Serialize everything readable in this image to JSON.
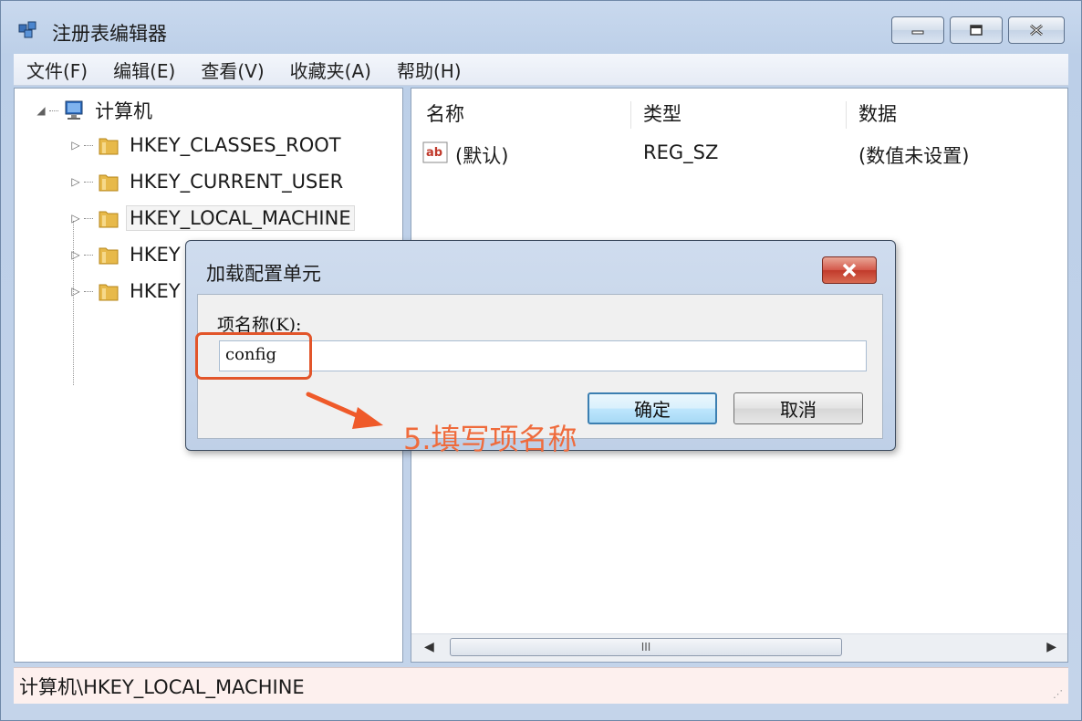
{
  "window": {
    "title": "注册表编辑器",
    "controls": {
      "minimize": "minimize-icon",
      "maximize": "maximize-icon",
      "close": "close-icon"
    }
  },
  "menu": {
    "items": [
      {
        "label": "文件(F)"
      },
      {
        "label": "编辑(E)"
      },
      {
        "label": "查看(V)"
      },
      {
        "label": "收藏夹(A)"
      },
      {
        "label": "帮助(H)"
      }
    ]
  },
  "tree": {
    "root": {
      "label": "计算机",
      "icon": "computer-icon"
    },
    "nodes": [
      {
        "label": "HKEY_CLASSES_ROOT"
      },
      {
        "label": "HKEY_CURRENT_USER"
      },
      {
        "label": "HKEY_LOCAL_MACHINE",
        "selected": true
      },
      {
        "label": "HKEY"
      },
      {
        "label": "HKEY"
      }
    ]
  },
  "list": {
    "columns": [
      "名称",
      "类型",
      "数据"
    ],
    "rows": [
      {
        "name": "(默认)",
        "type": "REG_SZ",
        "data": "(数值未设置)",
        "icon": "string-value-icon"
      }
    ],
    "scroll_thumb": "III"
  },
  "status": {
    "path": "计算机\\HKEY_LOCAL_MACHINE"
  },
  "dialog": {
    "title": "加载配置单元",
    "field_label": "项名称(K):",
    "field_value": "config",
    "ok_label": "确定",
    "cancel_label": "取消"
  },
  "annotation": {
    "text": "5.填写项名称",
    "color": "#ef6b3c"
  },
  "colors": {
    "highlight": "#e2552a",
    "close_red": "#c13a2b"
  }
}
